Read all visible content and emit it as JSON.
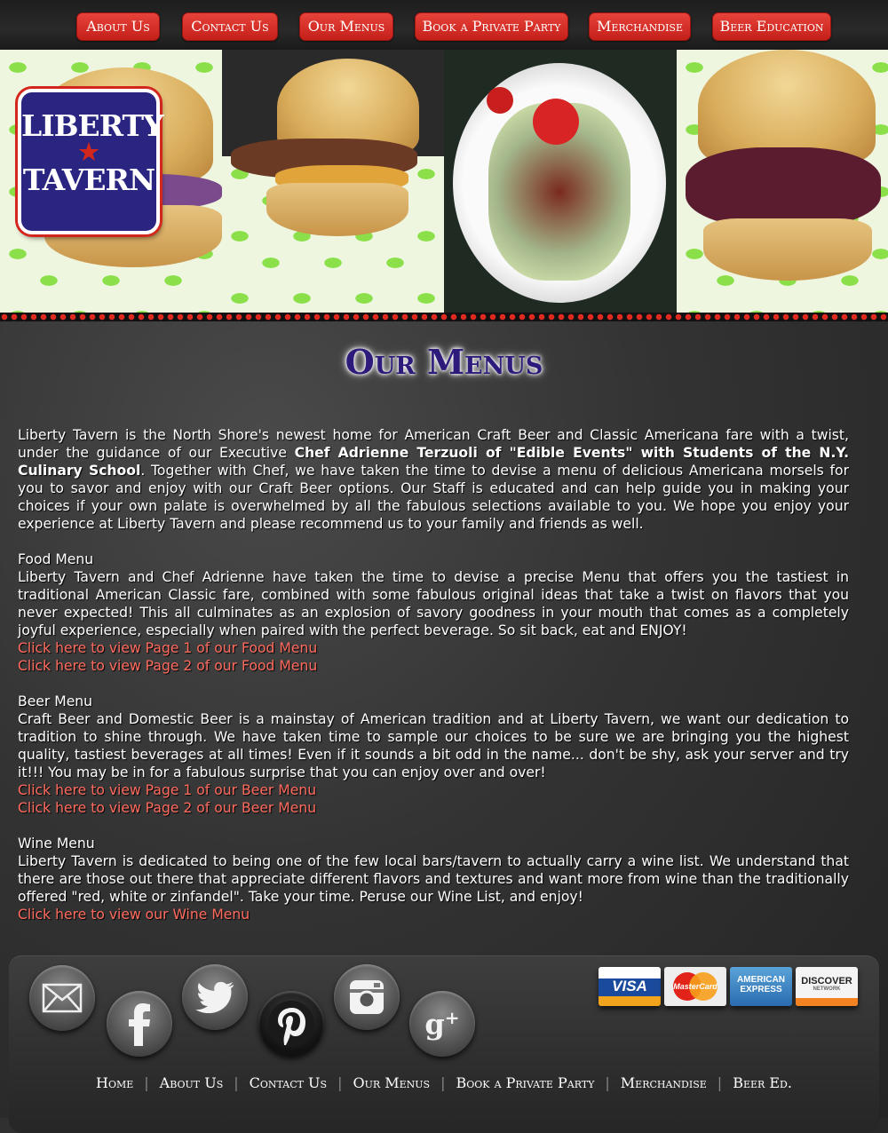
{
  "nav": [
    {
      "label": "About Us"
    },
    {
      "label": "Contact Us"
    },
    {
      "label": "Our Menus"
    },
    {
      "label": "Book a Private Party"
    },
    {
      "label": "Merchandise"
    },
    {
      "label": "Beer Education"
    }
  ],
  "logo": {
    "line1": "LIBERTY",
    "line2": "TAVERN"
  },
  "page_title": "Our Menus",
  "intro": {
    "before": "Liberty Tavern is the North Shore's newest home for American Craft Beer and Classic Americana fare with a twist, under the guidance of our Executive ",
    "bold": "Chef Adrienne Terzuoli of \"Edible Events\" with Students of the N.Y. Culinary School",
    "after": ". Together with Chef, we have taken the time to devise a menu of delicious Americana morsels for you to savor and enjoy with our Craft Beer options. Our Staff is educated and can help guide you in making your choices if your own palate is overwhelmed by all the fabulous selections available to you. We hope you enjoy your experience at Liberty Tavern and please recommend us to your family and friends as well."
  },
  "food": {
    "heading": "Food Menu",
    "text": "Liberty Tavern and Chef Adrienne have taken the time to devise a precise Menu that offers you the tastiest in traditional American Classic fare, combined with some fabulous original ideas that take a twist on flavors that you never expected! This all culminates as an explosion of savory goodness in your mouth that comes as a completely joyful experience, especially when paired with the perfect beverage. So sit back, eat and ENJOY!",
    "link1": "Click here to view Page 1 of our Food Menu",
    "link2": "Click here to view Page 2 of our Food Menu"
  },
  "beer": {
    "heading": "Beer Menu",
    "text": "Craft Beer and Domestic Beer is a mainstay of American tradition and at Liberty Tavern, we want our dedication to tradition to shine through. We have taken time to sample our choices to be sure we are bringing you the highest quality, tastiest beverages at all times! Even if it sounds a bit odd in the name... don't be shy, ask your server and try it!!! You may be in for a fabulous surprise that you can enjoy over and over!",
    "link1": "Click here to view Page 1 of our Beer Menu",
    "link2": "Click here to view Page 2 of our Beer Menu"
  },
  "wine": {
    "heading": "Wine Menu",
    "text": "Liberty Tavern is dedicated to being one of the few local bars/tavern to actually carry a wine list. We understand that there are those out there that appreciate different flavors and textures and want more from wine than the traditionally offered \"red, white or zinfandel\". Take your time. Peruse our Wine List, and enjoy!",
    "link1": "Click here to view our Wine Menu"
  },
  "social_icons": [
    "email-icon",
    "facebook-icon",
    "twitter-icon",
    "pinterest-icon",
    "instagram-icon",
    "google-plus-icon"
  ],
  "cards": {
    "visa": "VISA",
    "mastercard": "MasterCard",
    "amex_1": "AMERICAN",
    "amex_2": "EXPRESS",
    "discover": "DISCOVER",
    "discover_sub": "NETWORK"
  },
  "footer_nav": [
    {
      "label": "Home"
    },
    {
      "label": "About Us"
    },
    {
      "label": "Contact Us"
    },
    {
      "label": "Our Menus"
    },
    {
      "label": "Book a Private Party"
    },
    {
      "label": "Merchandise"
    },
    {
      "label": "Beer Ed."
    }
  ],
  "colors": {
    "nav_red": "#d3261d",
    "link": "#ff6b5e",
    "title": "#2d1a7a",
    "logo_blue": "#2a2580"
  }
}
